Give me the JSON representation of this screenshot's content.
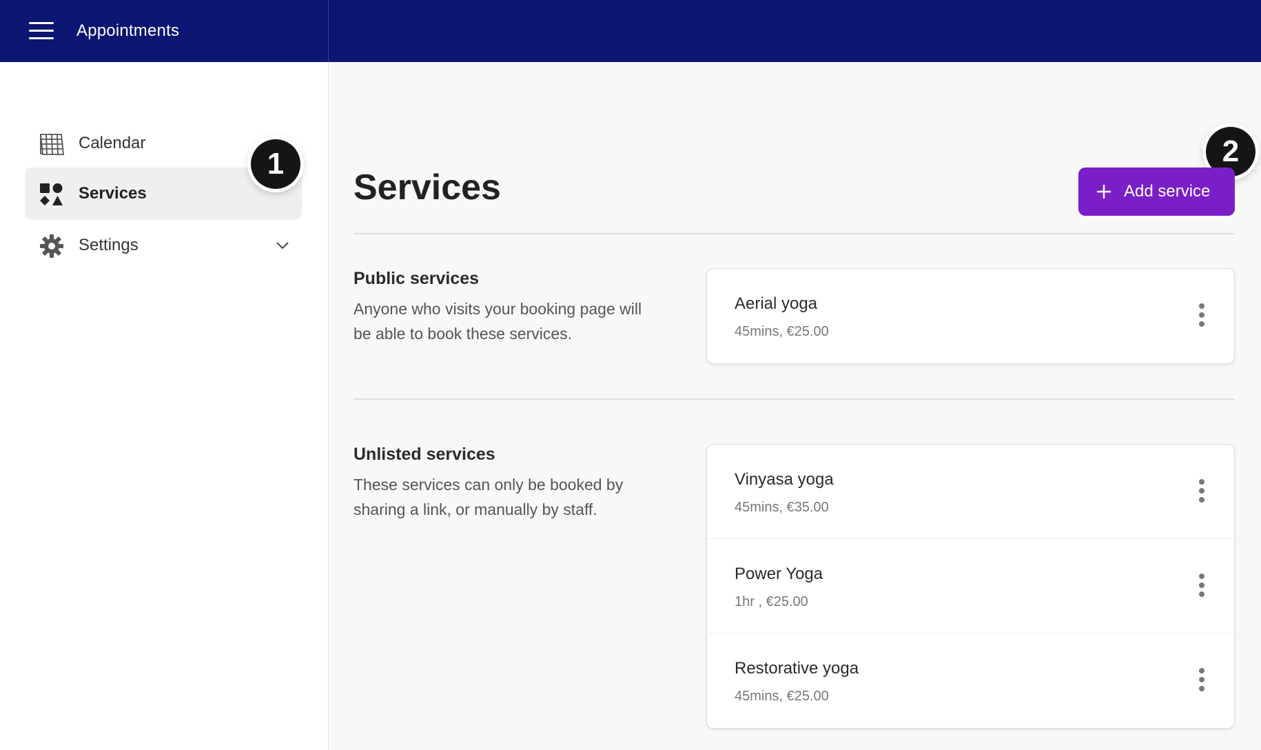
{
  "header": {
    "app_title": "Appointments"
  },
  "sidebar": {
    "items": [
      {
        "label": "Calendar",
        "icon": "calendar-grid-icon",
        "active": false
      },
      {
        "label": "Services",
        "icon": "shapes-icon",
        "active": true
      },
      {
        "label": "Settings",
        "icon": "gear-icon",
        "active": false,
        "expandable": true
      }
    ]
  },
  "badges": {
    "first": "1",
    "second": "2"
  },
  "main": {
    "title": "Services",
    "add_button_label": "Add service",
    "public": {
      "title": "Public services",
      "description": "Anyone who visits your booking page will be able to book these services.",
      "services": [
        {
          "name": "Aerial yoga",
          "meta": "45mins, €25.00"
        }
      ]
    },
    "unlisted": {
      "title": "Unlisted services",
      "description": "These services can only be booked by sharing a link, or manually by staff.",
      "services": [
        {
          "name": "Vinyasa yoga",
          "meta": "45mins, €35.00"
        },
        {
          "name": "Power Yoga",
          "meta": "1hr , €25.00"
        },
        {
          "name": "Restorative yoga",
          "meta": "45mins, €25.00"
        }
      ]
    }
  },
  "colors": {
    "topbar": "#0b1673",
    "accent": "#7a1fc8",
    "badge": "#151515"
  }
}
